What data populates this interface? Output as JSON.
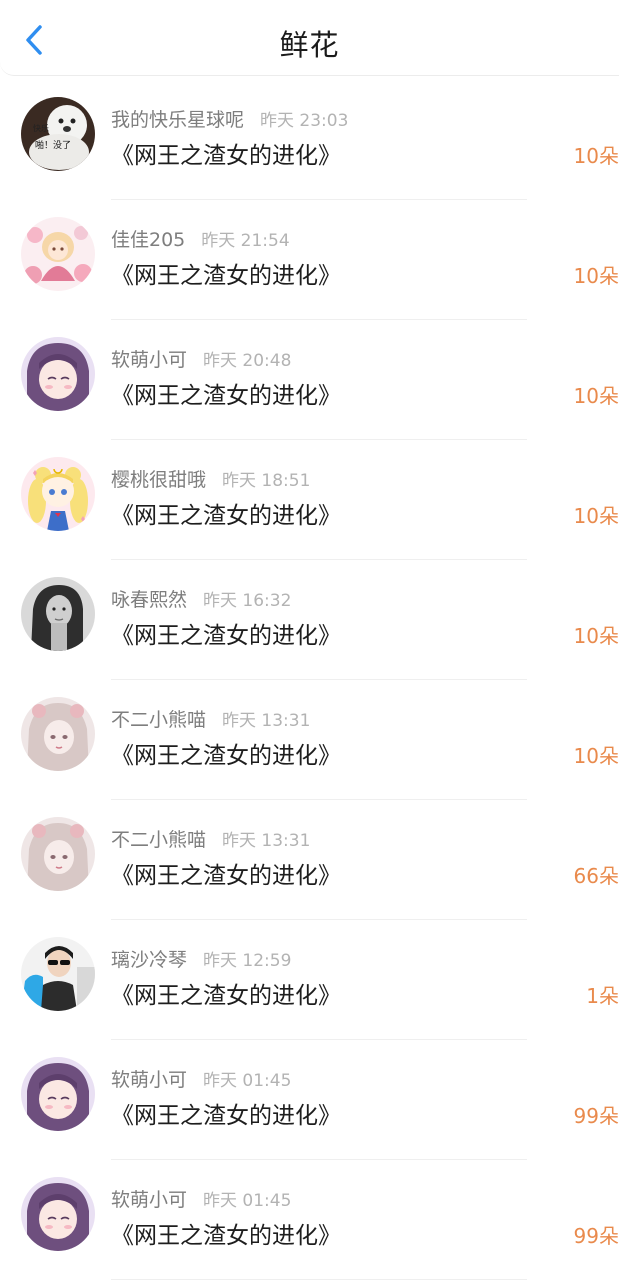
{
  "header": {
    "title": "鲜花",
    "back_icon": "chevron-left-icon",
    "accent": "#2f8ef0"
  },
  "count_color": "#e98a4c",
  "items": [
    {
      "username": "我的快乐星球呢",
      "time": "昨天 23:03",
      "book": "《网王之渣女的进化》",
      "count": "10朵",
      "avatar_text_1": "快乐",
      "avatar_text_2": "啪！没了"
    },
    {
      "username": "佳佳205",
      "time": "昨天 21:54",
      "book": "《网王之渣女的进化》",
      "count": "10朵"
    },
    {
      "username": "软萌小可",
      "time": "昨天 20:48",
      "book": "《网王之渣女的进化》",
      "count": "10朵"
    },
    {
      "username": "樱桃很甜哦",
      "time": "昨天 18:51",
      "book": "《网王之渣女的进化》",
      "count": "10朵"
    },
    {
      "username": "咏春熙然",
      "time": "昨天 16:32",
      "book": "《网王之渣女的进化》",
      "count": "10朵"
    },
    {
      "username": "不二小熊喵",
      "time": "昨天 13:31",
      "book": "《网王之渣女的进化》",
      "count": "10朵"
    },
    {
      "username": "不二小熊喵",
      "time": "昨天 13:31",
      "book": "《网王之渣女的进化》",
      "count": "66朵"
    },
    {
      "username": "璃沙冷琴",
      "time": "昨天 12:59",
      "book": "《网王之渣女的进化》",
      "count": "1朵"
    },
    {
      "username": "软萌小可",
      "time": "昨天 01:45",
      "book": "《网王之渣女的进化》",
      "count": "99朵"
    },
    {
      "username": "软萌小可",
      "time": "昨天 01:45",
      "book": "《网王之渣女的进化》",
      "count": "99朵"
    }
  ]
}
